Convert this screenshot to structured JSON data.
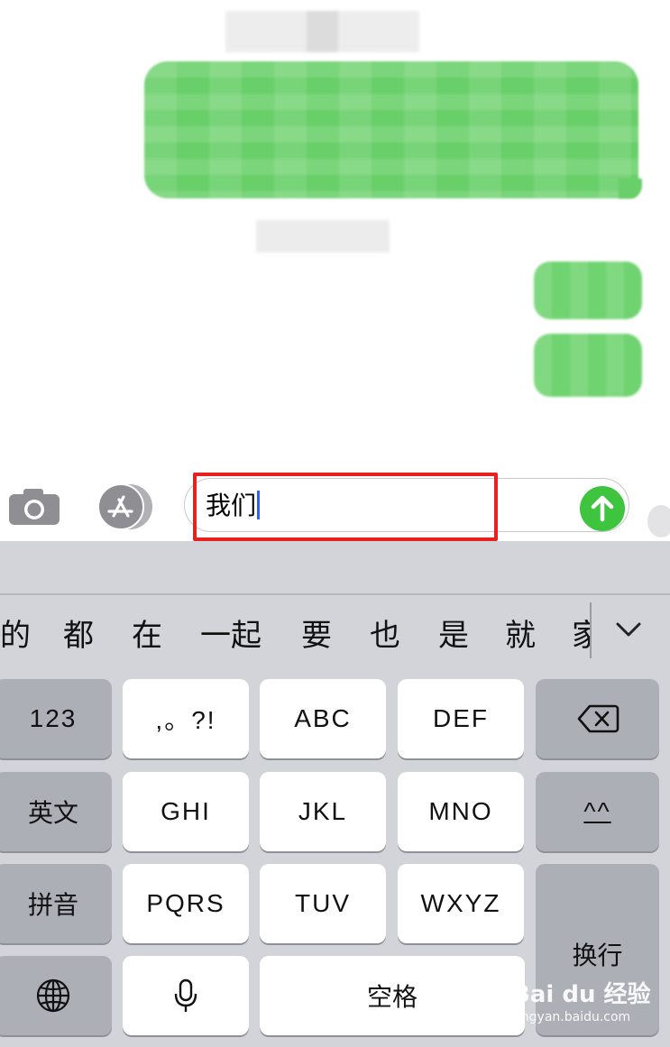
{
  "input": {
    "text": "我们",
    "send_icon": "arrow-up-icon"
  },
  "toolbar": {
    "camera_icon": "camera-icon",
    "appstore_icon": "app-store-icon"
  },
  "candidates": [
    "的",
    "都",
    "在",
    "一起",
    "要",
    "也",
    "是",
    "就",
    "家"
  ],
  "keyboard": {
    "row1": {
      "left": "123",
      "k1": ",。?!",
      "k2": "ABC",
      "k3": "DEF",
      "right_icon": "backspace-icon"
    },
    "row2": {
      "left": "英文",
      "k1": "GHI",
      "k2": "JKL",
      "k3": "MNO",
      "right": "^^"
    },
    "row3": {
      "left": "拼音",
      "k1": "PQRS",
      "k2": "TUV",
      "k3": "WXYZ"
    },
    "row4": {
      "left_icon": "globe-icon",
      "mic_icon": "microphone-icon",
      "space": "空格"
    },
    "return": "换行"
  },
  "watermark": {
    "logo": "Bai du 经验",
    "url": "jingyan.baidu.com"
  },
  "colors": {
    "bubble_green": "#69cf69",
    "send_green": "#3ec43f",
    "highlight_red": "#e8201e",
    "caret_blue": "#2f63e0",
    "keyboard_bg": "#d2d4da"
  }
}
